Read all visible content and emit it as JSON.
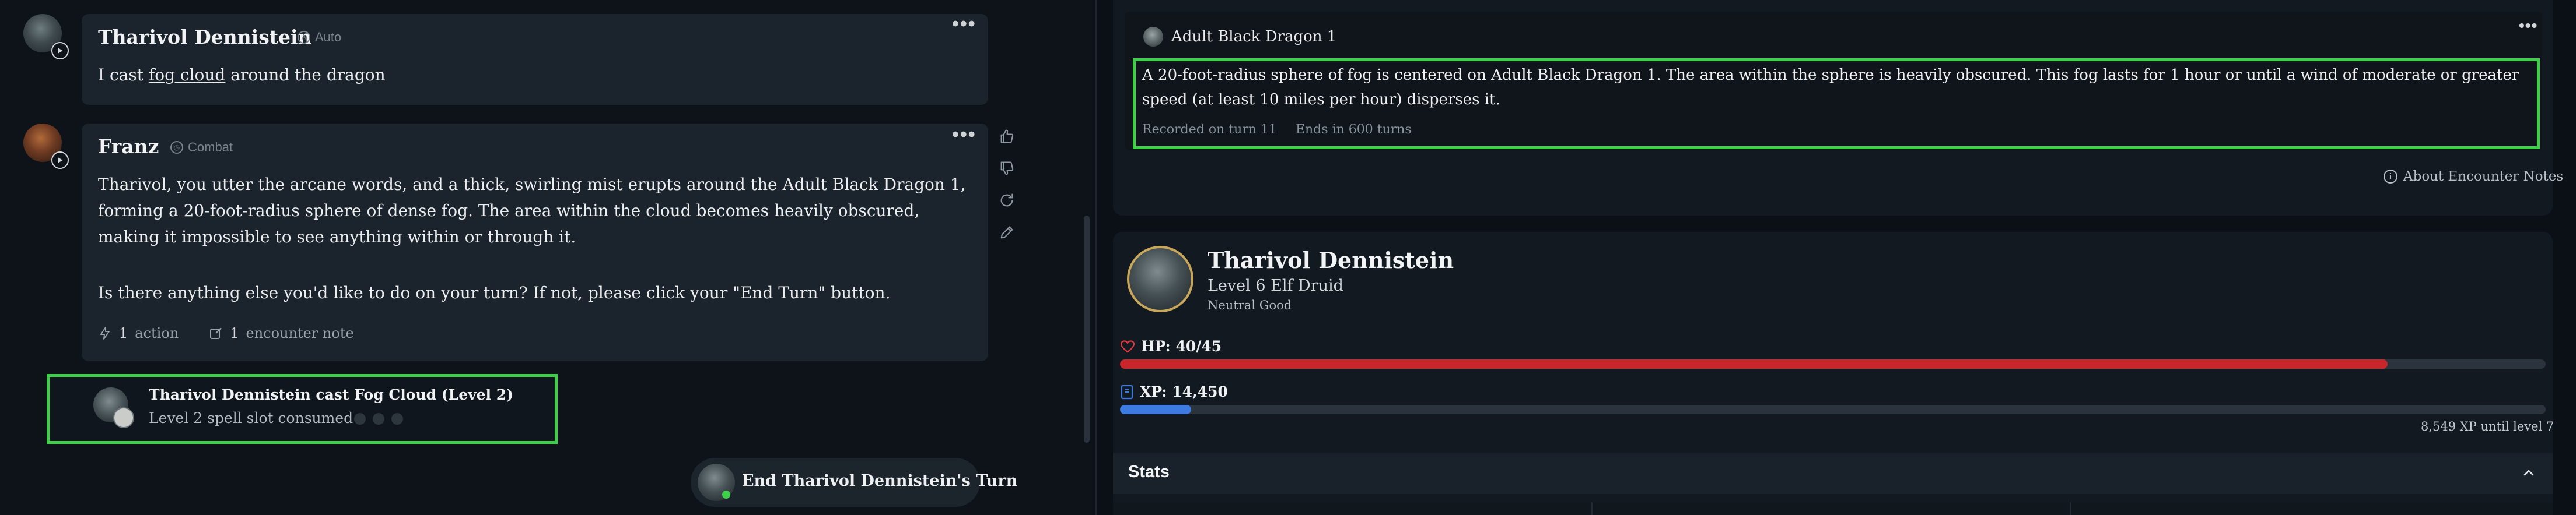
{
  "chat": {
    "msg1": {
      "name": "Tharivol Dennistein",
      "tag": "Auto",
      "text_prefix": "I cast ",
      "text_link": "fog cloud",
      "text_suffix": " around the dragon"
    },
    "msg2": {
      "name": "Franz",
      "tag": "Combat",
      "paragraph1": "Tharivol, you utter the arcane words, and a thick, swirling mist erupts around the Adult Black Dragon 1, forming a 20-foot-radius sphere of dense fog. The area within the cloud becomes heavily obscured, making it impossible to see anything within or through it.",
      "paragraph2": "Is there anything else you'd like to do on your turn? If not, please click your \"End Turn\" button.",
      "action_count": "1",
      "action_label": "action",
      "note_count": "1",
      "note_label": "encounter note"
    },
    "spell_event": {
      "title": "Tharivol Dennistein cast Fog Cloud (Level 2)",
      "subtitle": "Level 2 spell slot consumed"
    },
    "end_turn_label": "End Tharivol Dennistein's Turn"
  },
  "encounter_note": {
    "creature": "Adult Black Dragon 1",
    "text": "A 20-foot-radius sphere of fog is centered on Adult Black Dragon 1. The area within the sphere is heavily obscured. This fog lasts for 1 hour or until a wind of moderate or greater speed (at least 10 miles per hour) disperses it.",
    "recorded": "Recorded on turn 11",
    "ends": "Ends in 600 turns",
    "about_label": "About Encounter Notes"
  },
  "character": {
    "name": "Tharivol Dennistein",
    "class_line": "Level 6 Elf Druid",
    "alignment": "Neutral Good",
    "hp_label": "HP: 40/45",
    "hp_fraction": 0.889,
    "xp_label": "XP: 14,450",
    "xp_fraction": 0.05,
    "xp_until": "8,549 XP until level 7",
    "stats_label": "Stats"
  },
  "colors": {
    "highlight_border": "#3fcf4a",
    "hp_bar": "#c8262b",
    "xp_bar": "#3d7be0",
    "portrait_ring": "#c9a75a"
  }
}
